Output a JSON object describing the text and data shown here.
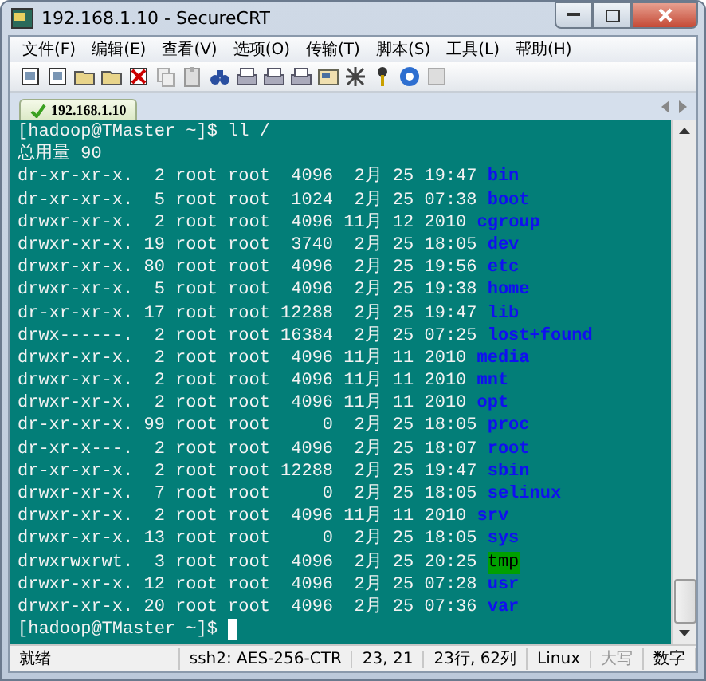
{
  "window": {
    "title": "192.168.1.10 - SecureCRT"
  },
  "menu": [
    "文件(F)",
    "编辑(E)",
    "查看(V)",
    "选项(O)",
    "传输(T)",
    "脚本(S)",
    "工具(L)",
    "帮助(H)"
  ],
  "tabs": [
    {
      "label": "192.168.1.10",
      "selected": true,
      "connected": true
    }
  ],
  "terminal": {
    "lines": [
      {
        "kind": "text",
        "text": "[hadoop@TMaster ~]$ ll /"
      },
      {
        "kind": "text",
        "text": "总用量 90"
      },
      {
        "kind": "entry",
        "info": "dr-xr-xr-x.  2 root root  4096  2月 25 19:47",
        "name": "bin",
        "sticky": false
      },
      {
        "kind": "entry",
        "info": "dr-xr-xr-x.  5 root root  1024  2月 25 07:38",
        "name": "boot",
        "sticky": false
      },
      {
        "kind": "entry",
        "info": "drwxr-xr-x.  2 root root  4096 11月 12 2010",
        "name": "cgroup",
        "sticky": false
      },
      {
        "kind": "entry",
        "info": "drwxr-xr-x. 19 root root  3740  2月 25 18:05",
        "name": "dev",
        "sticky": false
      },
      {
        "kind": "entry",
        "info": "drwxr-xr-x. 80 root root  4096  2月 25 19:56",
        "name": "etc",
        "sticky": false
      },
      {
        "kind": "entry",
        "info": "drwxr-xr-x.  5 root root  4096  2月 25 19:38",
        "name": "home",
        "sticky": false
      },
      {
        "kind": "entry",
        "info": "dr-xr-xr-x. 17 root root 12288  2月 25 19:47",
        "name": "lib",
        "sticky": false
      },
      {
        "kind": "entry",
        "info": "drwx------.  2 root root 16384  2月 25 07:25",
        "name": "lost+found",
        "sticky": false
      },
      {
        "kind": "entry",
        "info": "drwxr-xr-x.  2 root root  4096 11月 11 2010",
        "name": "media",
        "sticky": false
      },
      {
        "kind": "entry",
        "info": "drwxr-xr-x.  2 root root  4096 11月 11 2010",
        "name": "mnt",
        "sticky": false
      },
      {
        "kind": "entry",
        "info": "drwxr-xr-x.  2 root root  4096 11月 11 2010",
        "name": "opt",
        "sticky": false
      },
      {
        "kind": "entry",
        "info": "dr-xr-xr-x. 99 root root     0  2月 25 18:05",
        "name": "proc",
        "sticky": false
      },
      {
        "kind": "entry",
        "info": "dr-xr-x---.  2 root root  4096  2月 25 18:07",
        "name": "root",
        "sticky": false
      },
      {
        "kind": "entry",
        "info": "dr-xr-xr-x.  2 root root 12288  2月 25 19:47",
        "name": "sbin",
        "sticky": false
      },
      {
        "kind": "entry",
        "info": "drwxr-xr-x.  7 root root     0  2月 25 18:05",
        "name": "selinux",
        "sticky": false
      },
      {
        "kind": "entry",
        "info": "drwxr-xr-x.  2 root root  4096 11月 11 2010",
        "name": "srv",
        "sticky": false
      },
      {
        "kind": "entry",
        "info": "drwxr-xr-x. 13 root root     0  2月 25 18:05",
        "name": "sys",
        "sticky": false
      },
      {
        "kind": "entry",
        "info": "drwxrwxrwt.  3 root root  4096  2月 25 20:25",
        "name": "tmp",
        "sticky": true
      },
      {
        "kind": "entry",
        "info": "drwxr-xr-x. 12 root root  4096  2月 25 07:28",
        "name": "usr",
        "sticky": false
      },
      {
        "kind": "entry",
        "info": "drwxr-xr-x. 20 root root  4096  2月 25 07:36",
        "name": "var",
        "sticky": false
      },
      {
        "kind": "prompt",
        "text": "[hadoop@TMaster ~]$"
      }
    ]
  },
  "status_bar": [
    {
      "text": "就绪",
      "disabled": false
    },
    {
      "text": "ssh2: AES-256-CTR",
      "disabled": false
    },
    {
      "text": "23, 21",
      "disabled": false
    },
    {
      "text": "23行, 62列",
      "disabled": false
    },
    {
      "text": "Linux",
      "disabled": false
    },
    {
      "text": "大写",
      "disabled": true
    },
    {
      "text": "数字",
      "disabled": false
    }
  ]
}
